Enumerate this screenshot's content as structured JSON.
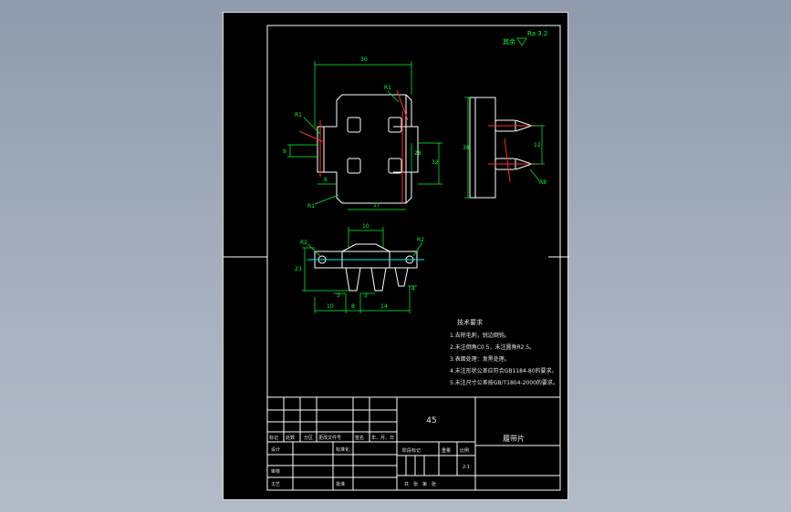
{
  "drawing": {
    "roughness_label": "其余",
    "roughness_value": "Ra 3.2",
    "views": {
      "top": {
        "dim_width": "30",
        "dim_inner": "17",
        "dim_left": "6",
        "dim_small": "9",
        "dim_height": "32",
        "dim_right": "28",
        "r_top_left": "R1",
        "r_top_right": "R1",
        "r_bottom_left": "R1"
      },
      "side": {
        "dim_height": "38",
        "dim_right": "12",
        "r_label": "R8"
      },
      "front": {
        "dim_width": "10",
        "dim_height": "23",
        "dim_a": "10",
        "dim_b": "8",
        "dim_c": "14",
        "dim_d": "3",
        "dim_e": "3",
        "dim_f": "4",
        "r_left": "R2",
        "r_right": "R2"
      }
    },
    "tech_req": {
      "title": "技术要求",
      "items": [
        "1.去除毛刺，锐边倒钝。",
        "2.未注倒角C0.5，未注圆角R2.5。",
        "3.表面处理：发黑处理。",
        "4.未注形状公差应符合GB1184-80的要求。",
        "5.未注尺寸公差按GB/T1804-2000的要求。"
      ]
    }
  },
  "title_block": {
    "material": "45",
    "part_name": "履带片",
    "headers": [
      "标记",
      "处数",
      "分区",
      "更改文件号",
      "签名",
      "年、月、日"
    ],
    "design": "设计",
    "standardize": "标准化",
    "stage_mark": "阶段标记",
    "weight": "重量",
    "scale": "比例",
    "scale_value": "2:1",
    "review": "审核",
    "process": "工艺",
    "approve": "批准",
    "sheets": "共　张　第　张"
  }
}
